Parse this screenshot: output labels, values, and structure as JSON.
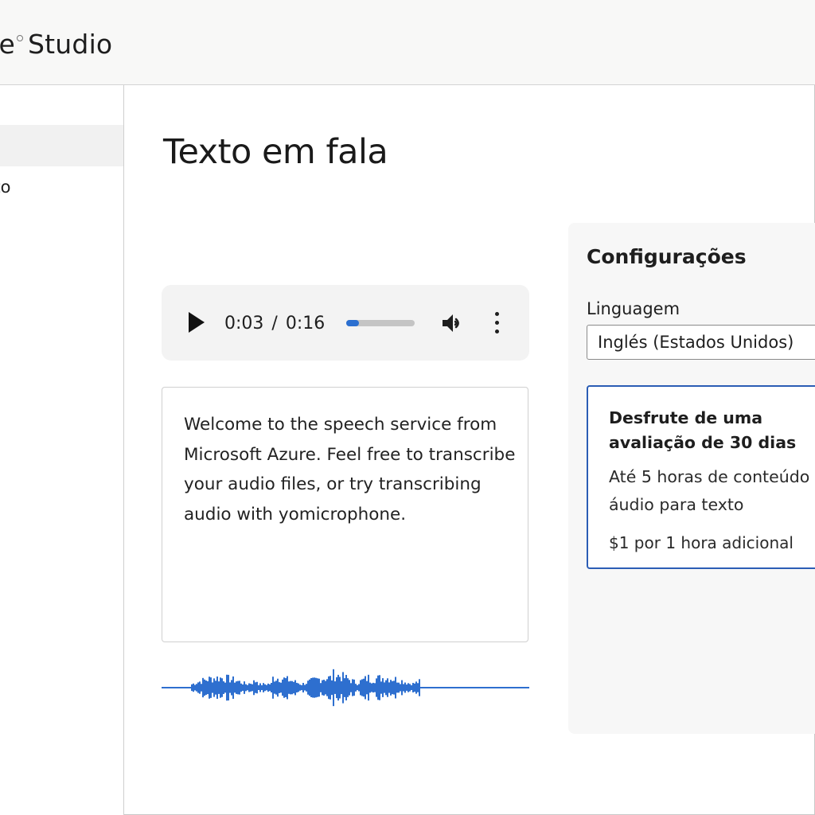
{
  "header": {
    "app_title": "ee",
    "app_title_suffix": "Studio"
  },
  "sidebar": {
    "items": [
      {
        "label": ""
      },
      {
        "label": "xto"
      }
    ]
  },
  "main": {
    "page_title": "Texto em fala",
    "player": {
      "current_time": "0:03",
      "separator": "/",
      "duration": "0:16",
      "progress": 0.19
    },
    "text_input": {
      "value": "Welcome to the speech service from Microsoft Azure. Feel free to transcribe your audio files, or try transcribing audio with yomicrophone."
    }
  },
  "settings": {
    "title": "Configurações",
    "language_label": "Linguagem",
    "language_value": "Inglés (Estados Unidos)",
    "trial": {
      "title": "Desfrute de uma avaliação de 30 dias",
      "description": "Até 5 horas de conteúdo áudio para texto",
      "price": "$1 por 1 hora adicional"
    }
  },
  "colors": {
    "accent": "#2b6fd0",
    "card_border": "#2b5db5",
    "waveform": "#2e6fcf"
  },
  "icons": {
    "play": "play-icon",
    "volume": "volume-icon",
    "more": "more-vertical-icon"
  }
}
